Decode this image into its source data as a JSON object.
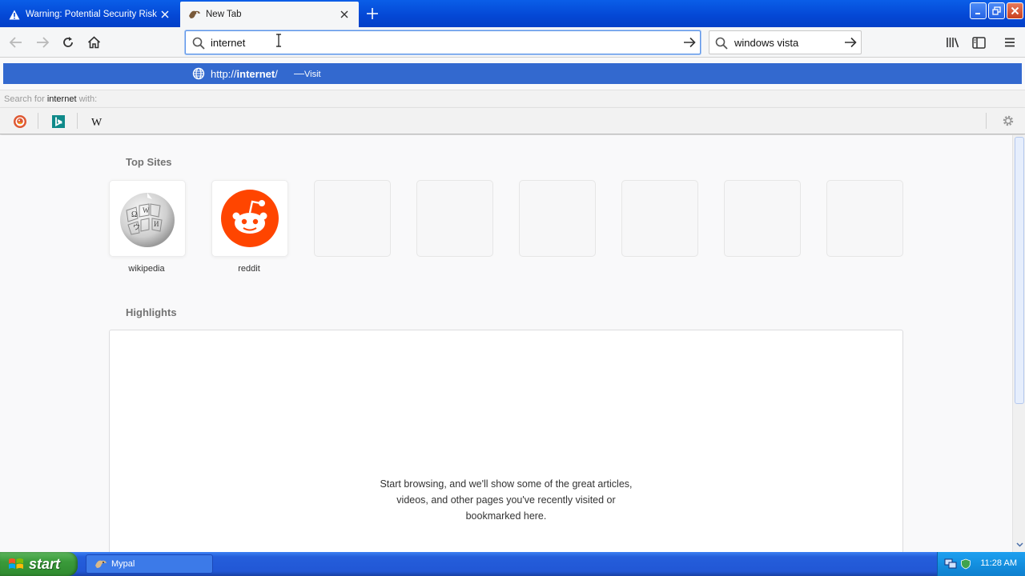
{
  "tabs": [
    {
      "title": "Warning: Potential Security Risk A",
      "icon": "warning-icon",
      "active": false
    },
    {
      "title": "New Tab",
      "icon": "mypal-icon",
      "active": true
    }
  ],
  "navbar": {
    "url_value": "internet",
    "search_value": "windows vista"
  },
  "autocomplete": {
    "url_prefix": "http://",
    "url_term": "internet",
    "url_suffix": "/",
    "dash": "—",
    "action": "Visit",
    "search_for_prefix": "Search for",
    "search_term": "internet",
    "search_for_suffix": "with:",
    "engines": [
      "duckduckgo-icon",
      "bing-icon",
      "wikipedia-icon"
    ]
  },
  "content": {
    "top_sites_title": "Top Sites",
    "top_sites": [
      {
        "label": "wikipedia",
        "icon": "wikipedia-globe-icon"
      },
      {
        "label": "reddit",
        "icon": "reddit-icon"
      },
      {
        "label": ""
      },
      {
        "label": ""
      },
      {
        "label": ""
      },
      {
        "label": ""
      },
      {
        "label": ""
      },
      {
        "label": ""
      }
    ],
    "highlights_title": "Highlights",
    "highlights_line1": "Start browsing, and we'll show some of the great articles,",
    "highlights_line2": "videos, and other pages you've recently visited or",
    "highlights_line3": "bookmarked here."
  },
  "taskbar": {
    "start_label": "start",
    "task_label": "Mypal",
    "clock": "11:28 AM"
  },
  "colors": {
    "accent": "#3369cf",
    "reddit": "#ff4500",
    "taskbar": "#245edb",
    "start": "#3a9a3a"
  }
}
